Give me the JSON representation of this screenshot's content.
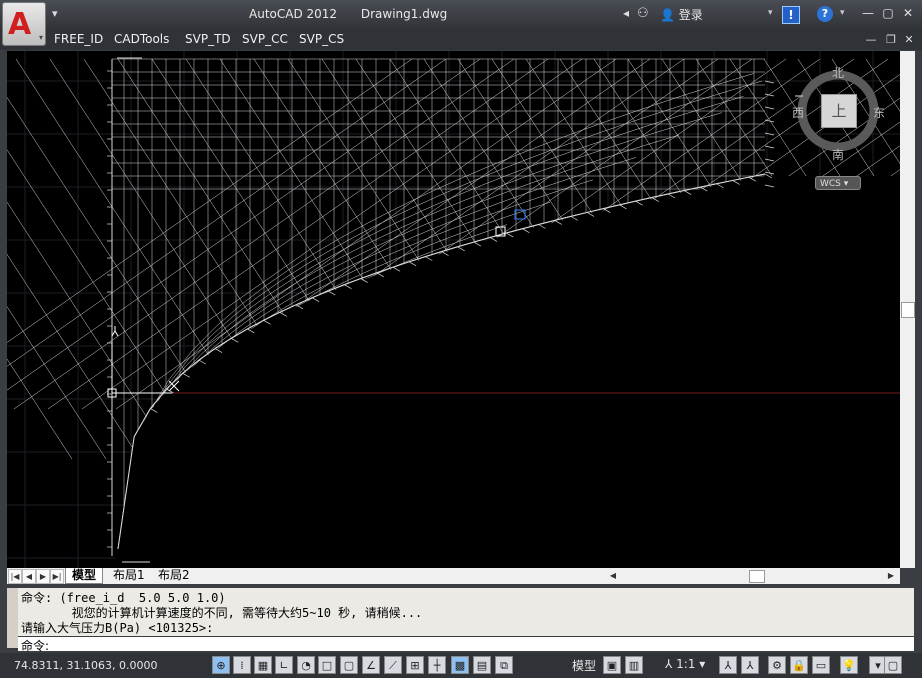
{
  "title": {
    "app": "AutoCAD 2012",
    "document": "Drawing1.dwg"
  },
  "toolbar": {
    "quick_access_dropdown": "▾",
    "login": "登录"
  },
  "menu": {
    "items": [
      "FREE_ID",
      "CADTools",
      "SVP_TD",
      "SVP_CC",
      "SVP_CS"
    ]
  },
  "viewcube": {
    "north": "北",
    "south": "南",
    "west": "西",
    "east": "东",
    "face": "上",
    "wcs": "WCS ▾"
  },
  "tabs": {
    "items": [
      "模型",
      "布局1",
      "布局2"
    ],
    "active": "模型"
  },
  "command": {
    "history": [
      "命令: (free_i_d  5.0 5.0 1.0)",
      "       视您的计算机计算速度的不同, 需等待大约5~10 秒, 请稍候...",
      "请输入大气压力B(Pa) <101325>:"
    ],
    "prompt": "命令:"
  },
  "status": {
    "coordinates": "74.8311,  31.1063, 0.0000",
    "model_label": "模型",
    "annotation_scale": "1:1 ▾"
  },
  "colors": {
    "viewport_bg": "#000000",
    "grid_line": "#d8d8d8",
    "x_axis": "#7a1c1c",
    "selection": "#2f6fd6"
  },
  "icons": {
    "app_menu": "autocad-logo-icon",
    "help": "help-icon",
    "exchange": "exchange-icon"
  }
}
